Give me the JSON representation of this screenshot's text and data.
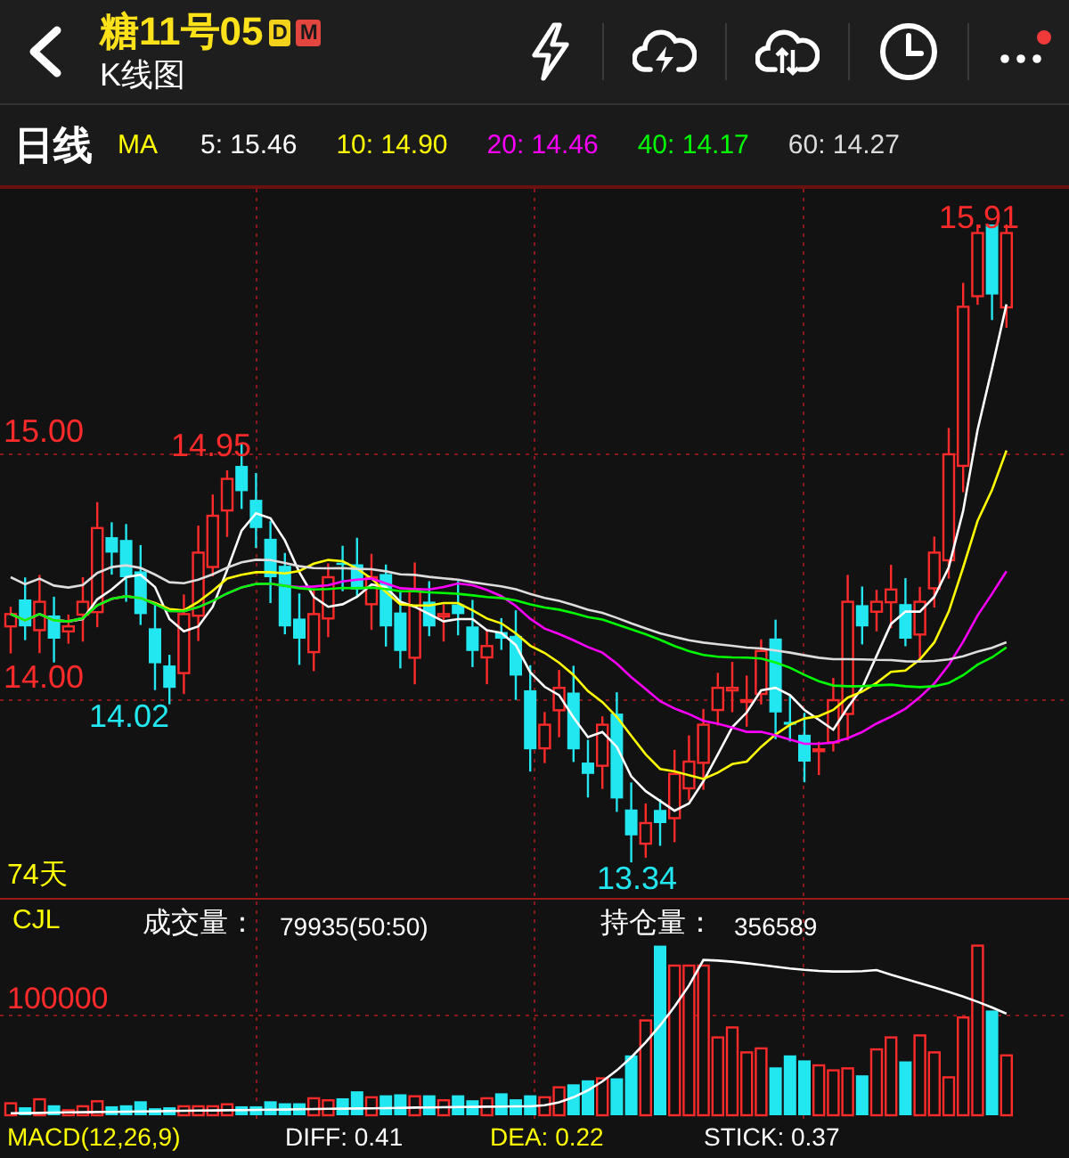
{
  "header": {
    "title": "糖11号05",
    "badges": [
      {
        "text": "D",
        "color": "#f2d21b"
      },
      {
        "text": "M",
        "color": "#e2463f"
      }
    ],
    "subtitle": "K线图"
  },
  "ma_bar": {
    "period": "日线",
    "label": "MA",
    "items": [
      {
        "text": "5: 15.46",
        "color": "#ffffff"
      },
      {
        "text": "10: 14.90",
        "color": "#ffff00"
      },
      {
        "text": "20: 14.46",
        "color": "#ff00ff"
      },
      {
        "text": "40: 14.17",
        "color": "#00ff00"
      },
      {
        "text": "60: 14.27",
        "color": "#dddddd"
      }
    ]
  },
  "price_chart": {
    "labels": [
      {
        "text": "15.91",
        "color": "#ff2a2a"
      },
      {
        "text": "15.00",
        "color": "#ff2a2a"
      },
      {
        "text": "14.95",
        "color": "#ff2a2a"
      },
      {
        "text": "14.00",
        "color": "#ff2a2a"
      },
      {
        "text": "14.02",
        "color": "#22e6f0"
      },
      {
        "text": "13.34",
        "color": "#22e6f0"
      }
    ],
    "days": "74天"
  },
  "volume_panel": {
    "indicator": "CJL",
    "volume_label": "成交量：",
    "volume_value": "79935(50:50)",
    "oi_label": "持仓量：",
    "oi_value": "356589",
    "scale": "100000"
  },
  "macd_bar": {
    "items": [
      {
        "text": "MACD(12,26,9)",
        "color": "#ffff00"
      },
      {
        "text": "DIFF: 0.41",
        "color": "#ffffff"
      },
      {
        "text": "DEA: 0.22",
        "color": "#ffff00"
      },
      {
        "text": "STICK: 0.37",
        "color": "#ffffff"
      }
    ]
  }
}
